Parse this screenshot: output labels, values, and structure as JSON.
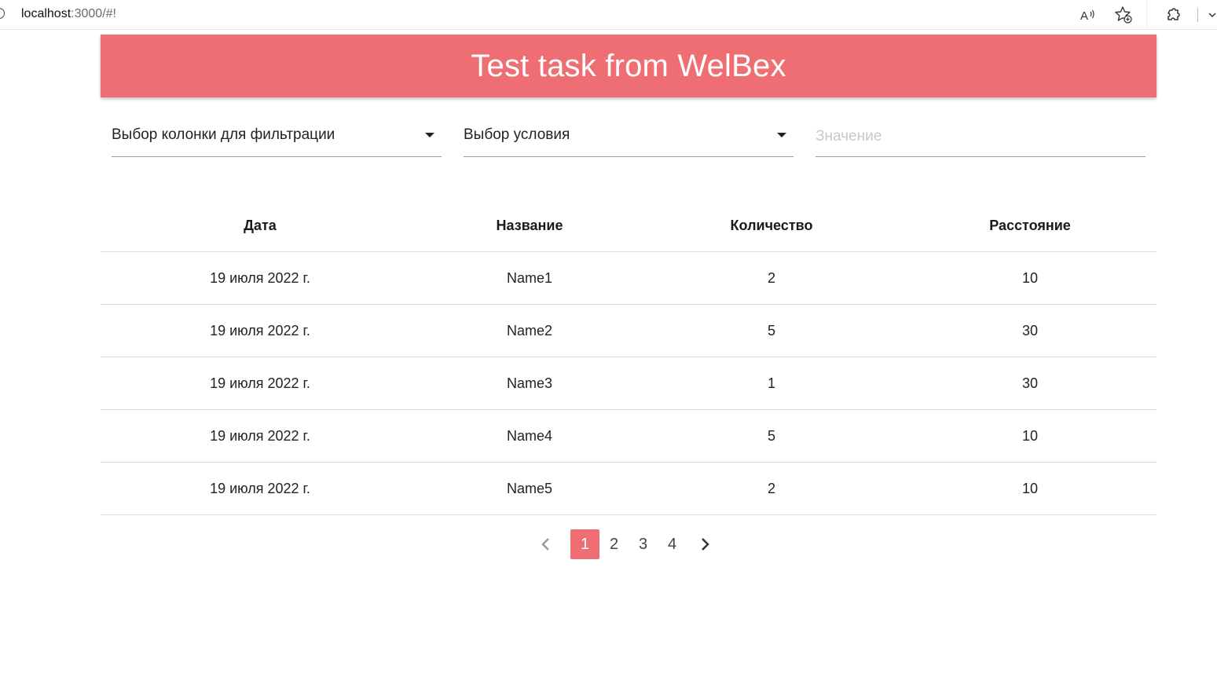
{
  "browser": {
    "url_host": "localhost",
    "url_rest": ":3000/#!"
  },
  "header": {
    "title": "Test task from WelBex"
  },
  "filters": {
    "column_select": "Выбор колонки для фильтрации",
    "condition_select": "Выбор условия",
    "value_placeholder": "Значение"
  },
  "table": {
    "columns": [
      "Дата",
      "Название",
      "Количество",
      "Расстояние"
    ],
    "rows": [
      [
        "19 июля 2022 г.",
        "Name1",
        "2",
        "10"
      ],
      [
        "19 июля 2022 г.",
        "Name2",
        "5",
        "30"
      ],
      [
        "19 июля 2022 г.",
        "Name3",
        "1",
        "30"
      ],
      [
        "19 июля 2022 г.",
        "Name4",
        "5",
        "10"
      ],
      [
        "19 июля 2022 г.",
        "Name5",
        "2",
        "10"
      ]
    ]
  },
  "pagination": {
    "pages": [
      "1",
      "2",
      "3",
      "4"
    ],
    "current": "1"
  },
  "colors": {
    "accent": "#ef6e73"
  },
  "icons": {
    "site_info": "info-icon",
    "read_aloud": "read-aloud-icon",
    "favorite": "add-favorite-icon",
    "extensions": "extensions-icon",
    "prev": "chevron-left-icon",
    "next": "chevron-right-icon"
  }
}
